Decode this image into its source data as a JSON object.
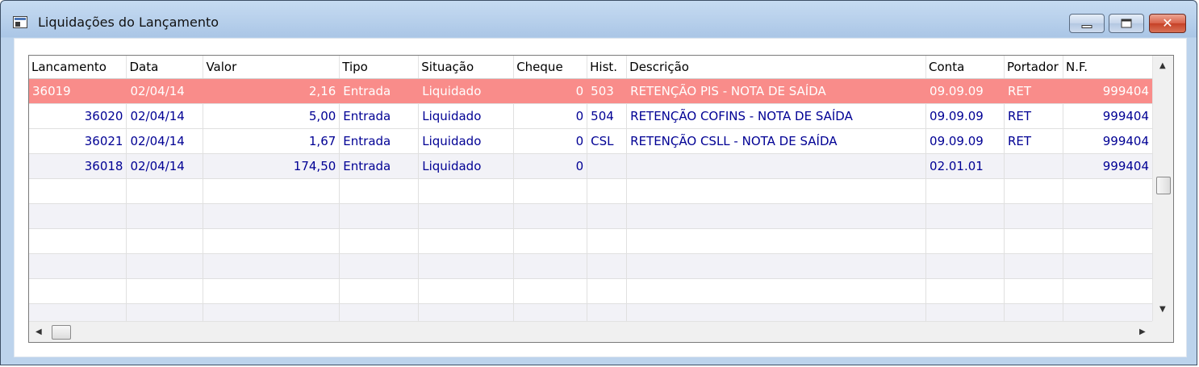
{
  "window": {
    "title": "Liquidações do Lançamento",
    "controls": {
      "minimize": "minimize-icon",
      "maximize": "maximize-icon",
      "close": "✕"
    }
  },
  "table": {
    "columns": [
      "Lancamento",
      "Data",
      "Valor",
      "Tipo",
      "Situação",
      "Cheque",
      "Hist.",
      "Descrição",
      "Conta",
      "Portador",
      "N.F."
    ],
    "rows": [
      {
        "lancamento": "36019",
        "data": "02/04/14",
        "valor": "2,16",
        "tipo": "Entrada",
        "situacao": "Liquidado",
        "cheque": "0",
        "hist": "503",
        "descricao": "RETENÇÃO PIS - NOTA DE SAÍDA",
        "conta": "09.09.09",
        "portador": "RET",
        "nf": "999404"
      },
      {
        "lancamento": "36020",
        "data": "02/04/14",
        "valor": "5,00",
        "tipo": "Entrada",
        "situacao": "Liquidado",
        "cheque": "0",
        "hist": "504",
        "descricao": "RETENÇÃO COFINS - NOTA DE SAÍDA",
        "conta": "09.09.09",
        "portador": "RET",
        "nf": "999404"
      },
      {
        "lancamento": "36021",
        "data": "02/04/14",
        "valor": "1,67",
        "tipo": "Entrada",
        "situacao": "Liquidado",
        "cheque": "0",
        "hist": "CSL",
        "descricao": "RETENÇÃO CSLL - NOTA DE SAÍDA",
        "conta": "09.09.09",
        "portador": "RET",
        "nf": "999404"
      },
      {
        "lancamento": "36018",
        "data": "02/04/14",
        "valor": "174,50",
        "tipo": "Entrada",
        "situacao": "Liquidado",
        "cheque": "0",
        "hist": "",
        "descricao": "",
        "conta": "02.01.01",
        "portador": "",
        "nf": "999404"
      }
    ],
    "selected_row": 0
  },
  "scrollbars": {
    "up": "▲",
    "down": "▼",
    "left": "◀",
    "right": "▶"
  },
  "colors": {
    "selected_row_bg": "#f98c8a",
    "cell_text": "#000094",
    "alt_row_bg": "#f2f2f7",
    "title_bar": "#b9d1ec"
  }
}
